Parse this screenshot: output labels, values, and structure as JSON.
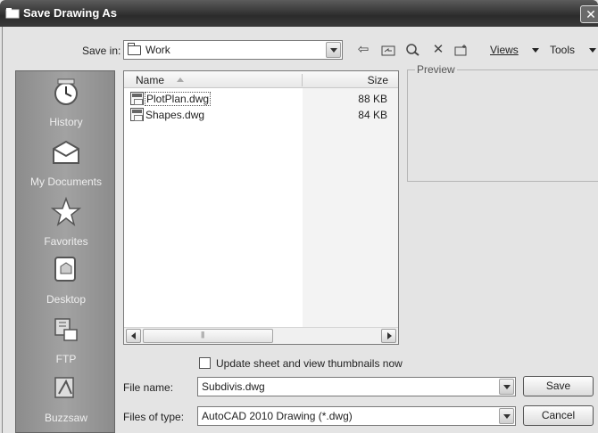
{
  "window": {
    "title": "Save Drawing As",
    "close_glyph": "✕"
  },
  "toolbar": {
    "save_in_label": "Save in:",
    "save_in_value": "Work",
    "back_glyph": "⇦",
    "up_glyph": "⊡",
    "search_glyph": "Q",
    "delete_glyph": "✕",
    "new_folder_glyph": "▭",
    "views_label": "Views",
    "tools_label": "Tools"
  },
  "places": [
    {
      "label": "History",
      "icon": "history-icon"
    },
    {
      "label": "My Documents",
      "icon": "documents-icon"
    },
    {
      "label": "Favorites",
      "icon": "favorites-icon"
    },
    {
      "label": "Desktop",
      "icon": "desktop-icon"
    },
    {
      "label": "FTP",
      "icon": "ftp-icon"
    },
    {
      "label": "Buzzsaw",
      "icon": "buzzsaw-icon"
    }
  ],
  "file_list": {
    "columns": {
      "name": "Name",
      "size": "Size"
    },
    "rows": [
      {
        "name": "PlotPlan.dwg",
        "size": "88 KB"
      },
      {
        "name": "Shapes.dwg",
        "size": "84 KB"
      }
    ]
  },
  "preview": {
    "label": "Preview"
  },
  "options": {
    "thumbnail_checkbox_label": "Update sheet and view thumbnails now",
    "thumbnail_checked": false
  },
  "form": {
    "file_name_label": "File name:",
    "file_name_value": "Subdivis.dwg",
    "file_type_label": "Files of type:",
    "file_type_value": "AutoCAD 2010 Drawing (*.dwg)",
    "save_label": "Save",
    "cancel_label": "Cancel"
  }
}
